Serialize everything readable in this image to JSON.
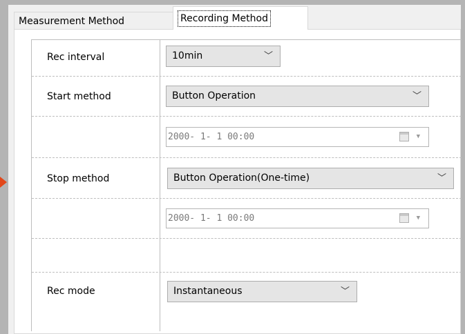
{
  "tabs": [
    {
      "label": "Measurement Method",
      "selected": false
    },
    {
      "label": "Recording Method",
      "selected": true
    }
  ],
  "form": {
    "rec_interval": {
      "label": "Rec interval",
      "value": "10min"
    },
    "start_method": {
      "label": "Start method",
      "value": "Button Operation",
      "datetime": "2000- 1- 1 00:00"
    },
    "stop_method": {
      "label": "Stop method",
      "value": "Button Operation(One-time)",
      "datetime": "2000- 1- 1 00:00"
    },
    "rec_mode": {
      "label": "Rec mode",
      "value": "Instantaneous"
    }
  },
  "icons": {
    "dropdown": "chevron-down-icon",
    "calendar": "calendar-icon",
    "pointer": "arrow-right-icon"
  },
  "colors": {
    "pointer_arrow": "#e2471a"
  }
}
